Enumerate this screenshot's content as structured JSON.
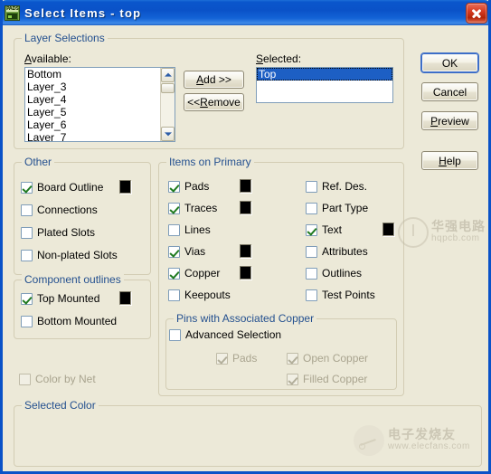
{
  "window": {
    "title": "Select Items - top",
    "icon": "pads-app-icon",
    "close_label": "Close",
    "titlebar_color": "#0a52c8"
  },
  "layer_selections": {
    "group_title": "Layer Selections",
    "available_label": "Available:",
    "available_items": [
      "Bottom",
      "Layer_3",
      "Layer_4",
      "Layer_5",
      "Layer_6",
      "Layer_7"
    ],
    "add_button": "Add >>",
    "remove_button": "<<Remove",
    "selected_label": "Selected:",
    "selected_items": [
      "Top"
    ],
    "selection_color": "#1d5fc4"
  },
  "action_buttons": {
    "ok": "OK",
    "cancel": "Cancel",
    "preview": "Preview",
    "help": "Help"
  },
  "other": {
    "group_title": "Other",
    "items": [
      {
        "label": "Board Outline",
        "checked": true,
        "swatch": "#000000"
      },
      {
        "label": "Connections",
        "checked": false,
        "swatch": null
      },
      {
        "label": "Plated Slots",
        "checked": false,
        "swatch": null
      },
      {
        "label": "Non-plated Slots",
        "checked": false,
        "swatch": null
      }
    ]
  },
  "component_outlines": {
    "group_title": "Component outlines",
    "items": [
      {
        "label": "Top Mounted",
        "checked": true,
        "swatch": "#000000"
      },
      {
        "label": "Bottom Mounted",
        "checked": false,
        "swatch": null
      }
    ]
  },
  "items_on_primary": {
    "group_title": "Items on Primary",
    "left_column": [
      {
        "label": "Pads",
        "checked": true,
        "swatch": "#000000"
      },
      {
        "label": "Traces",
        "checked": true,
        "swatch": "#000000"
      },
      {
        "label": "Lines",
        "checked": false,
        "swatch": null
      },
      {
        "label": "Vias",
        "checked": true,
        "swatch": "#000000"
      },
      {
        "label": "Copper",
        "checked": true,
        "swatch": "#000000"
      },
      {
        "label": "Keepouts",
        "checked": false,
        "swatch": null
      }
    ],
    "right_column": [
      {
        "label": "Ref. Des.",
        "checked": false,
        "swatch": null
      },
      {
        "label": "Part Type",
        "checked": false,
        "swatch": null
      },
      {
        "label": "Text",
        "checked": true,
        "swatch": "#000000"
      },
      {
        "label": "Attributes",
        "checked": false,
        "swatch": null
      },
      {
        "label": "Outlines",
        "checked": false,
        "swatch": null
      },
      {
        "label": "Test Points",
        "checked": false,
        "swatch": null
      }
    ]
  },
  "pins_with_copper": {
    "group_title": "Pins with Associated Copper",
    "advanced_selection": {
      "label": "Advanced Selection",
      "checked": false,
      "disabled": false
    },
    "sub_items": [
      {
        "label": "Pads",
        "checked": true,
        "disabled": true
      },
      {
        "label": "Open Copper",
        "checked": true,
        "disabled": true
      },
      {
        "label": "Filled Copper",
        "checked": true,
        "disabled": true
      }
    ]
  },
  "color_by_net": {
    "label": "Color by Net",
    "checked": false,
    "disabled": true
  },
  "selected_color": {
    "group_title": "Selected Color"
  },
  "watermarks": {
    "hqpcb": {
      "cn": "华强电路",
      "en": "hqpcb.com"
    },
    "elecfans": {
      "cn": "电子发烧友",
      "en": "www.elecfans.com"
    }
  }
}
